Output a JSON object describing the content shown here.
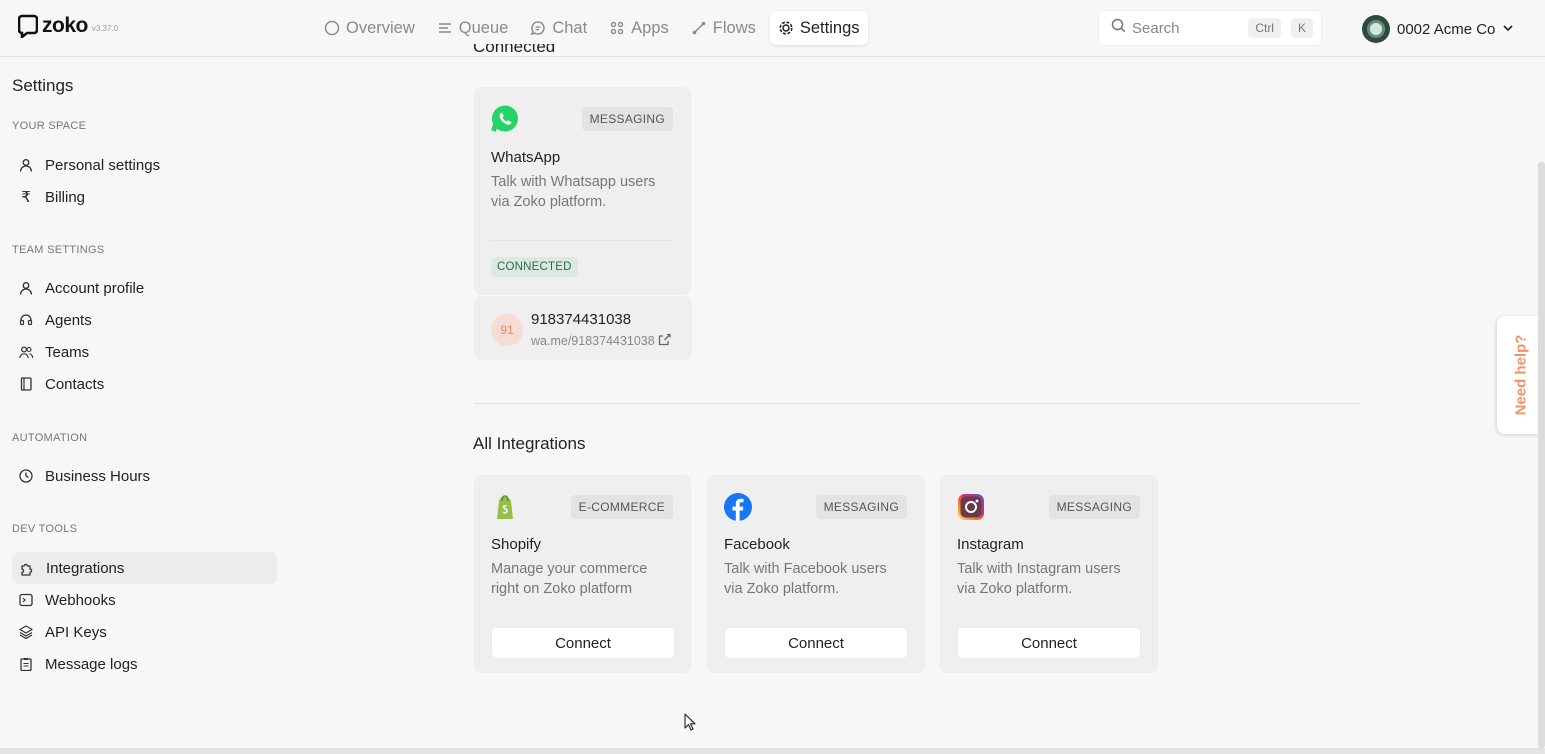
{
  "brand": {
    "name": "zoko",
    "version": "v3.37.0"
  },
  "nav": {
    "items": [
      {
        "label": "Overview",
        "icon": "circle-icon"
      },
      {
        "label": "Queue",
        "icon": "queue-icon"
      },
      {
        "label": "Chat",
        "icon": "chat-icon"
      },
      {
        "label": "Apps",
        "icon": "apps-icon"
      },
      {
        "label": "Flows",
        "icon": "flows-icon"
      },
      {
        "label": "Settings",
        "icon": "gear-icon",
        "active": true
      }
    ]
  },
  "search": {
    "placeholder": "Search",
    "shortcut_key1": "Ctrl",
    "shortcut_key2": "K"
  },
  "account": {
    "name": "0002 Acme Co"
  },
  "sidebar": {
    "title": "Settings",
    "sections": [
      {
        "label": "YOUR SPACE",
        "items": [
          "Personal settings",
          "Billing"
        ]
      },
      {
        "label": "TEAM SETTINGS",
        "items": [
          "Account profile",
          "Agents",
          "Teams",
          "Contacts"
        ]
      },
      {
        "label": "AUTOMATION",
        "items": [
          "Business Hours"
        ]
      },
      {
        "label": "DEV TOOLS",
        "items": [
          "Integrations",
          "Webhooks",
          "API Keys",
          "Message logs"
        ]
      }
    ],
    "active_item": "Integrations"
  },
  "connected": {
    "heading": "Connected",
    "card": {
      "badge": "MESSAGING",
      "title": "WhatsApp",
      "description": "Talk with Whatsapp users via Zoko platform.",
      "status": "CONNECTED"
    },
    "phone": {
      "country_code": "91",
      "number": "918374431038",
      "link": "wa.me/918374431038"
    }
  },
  "all_integrations": {
    "heading": "All Integrations",
    "cards": [
      {
        "badge": "E-COMMERCE",
        "title": "Shopify",
        "description": "Manage your commerce right on Zoko platform",
        "button": "Connect",
        "icon": "shopify-icon"
      },
      {
        "badge": "MESSAGING",
        "title": "Facebook",
        "description": "Talk with Facebook users via Zoko platform.",
        "button": "Connect",
        "icon": "facebook-icon"
      },
      {
        "badge": "MESSAGING",
        "title": "Instagram",
        "description": "Talk with Instagram users via Zoko platform.",
        "button": "Connect",
        "icon": "instagram-icon"
      }
    ]
  },
  "help": {
    "label": "Need help?"
  },
  "colors": {
    "accent": "#f0936a",
    "whatsapp": "#25d366",
    "facebook": "#1877f2",
    "shopify": "#95bf47"
  }
}
